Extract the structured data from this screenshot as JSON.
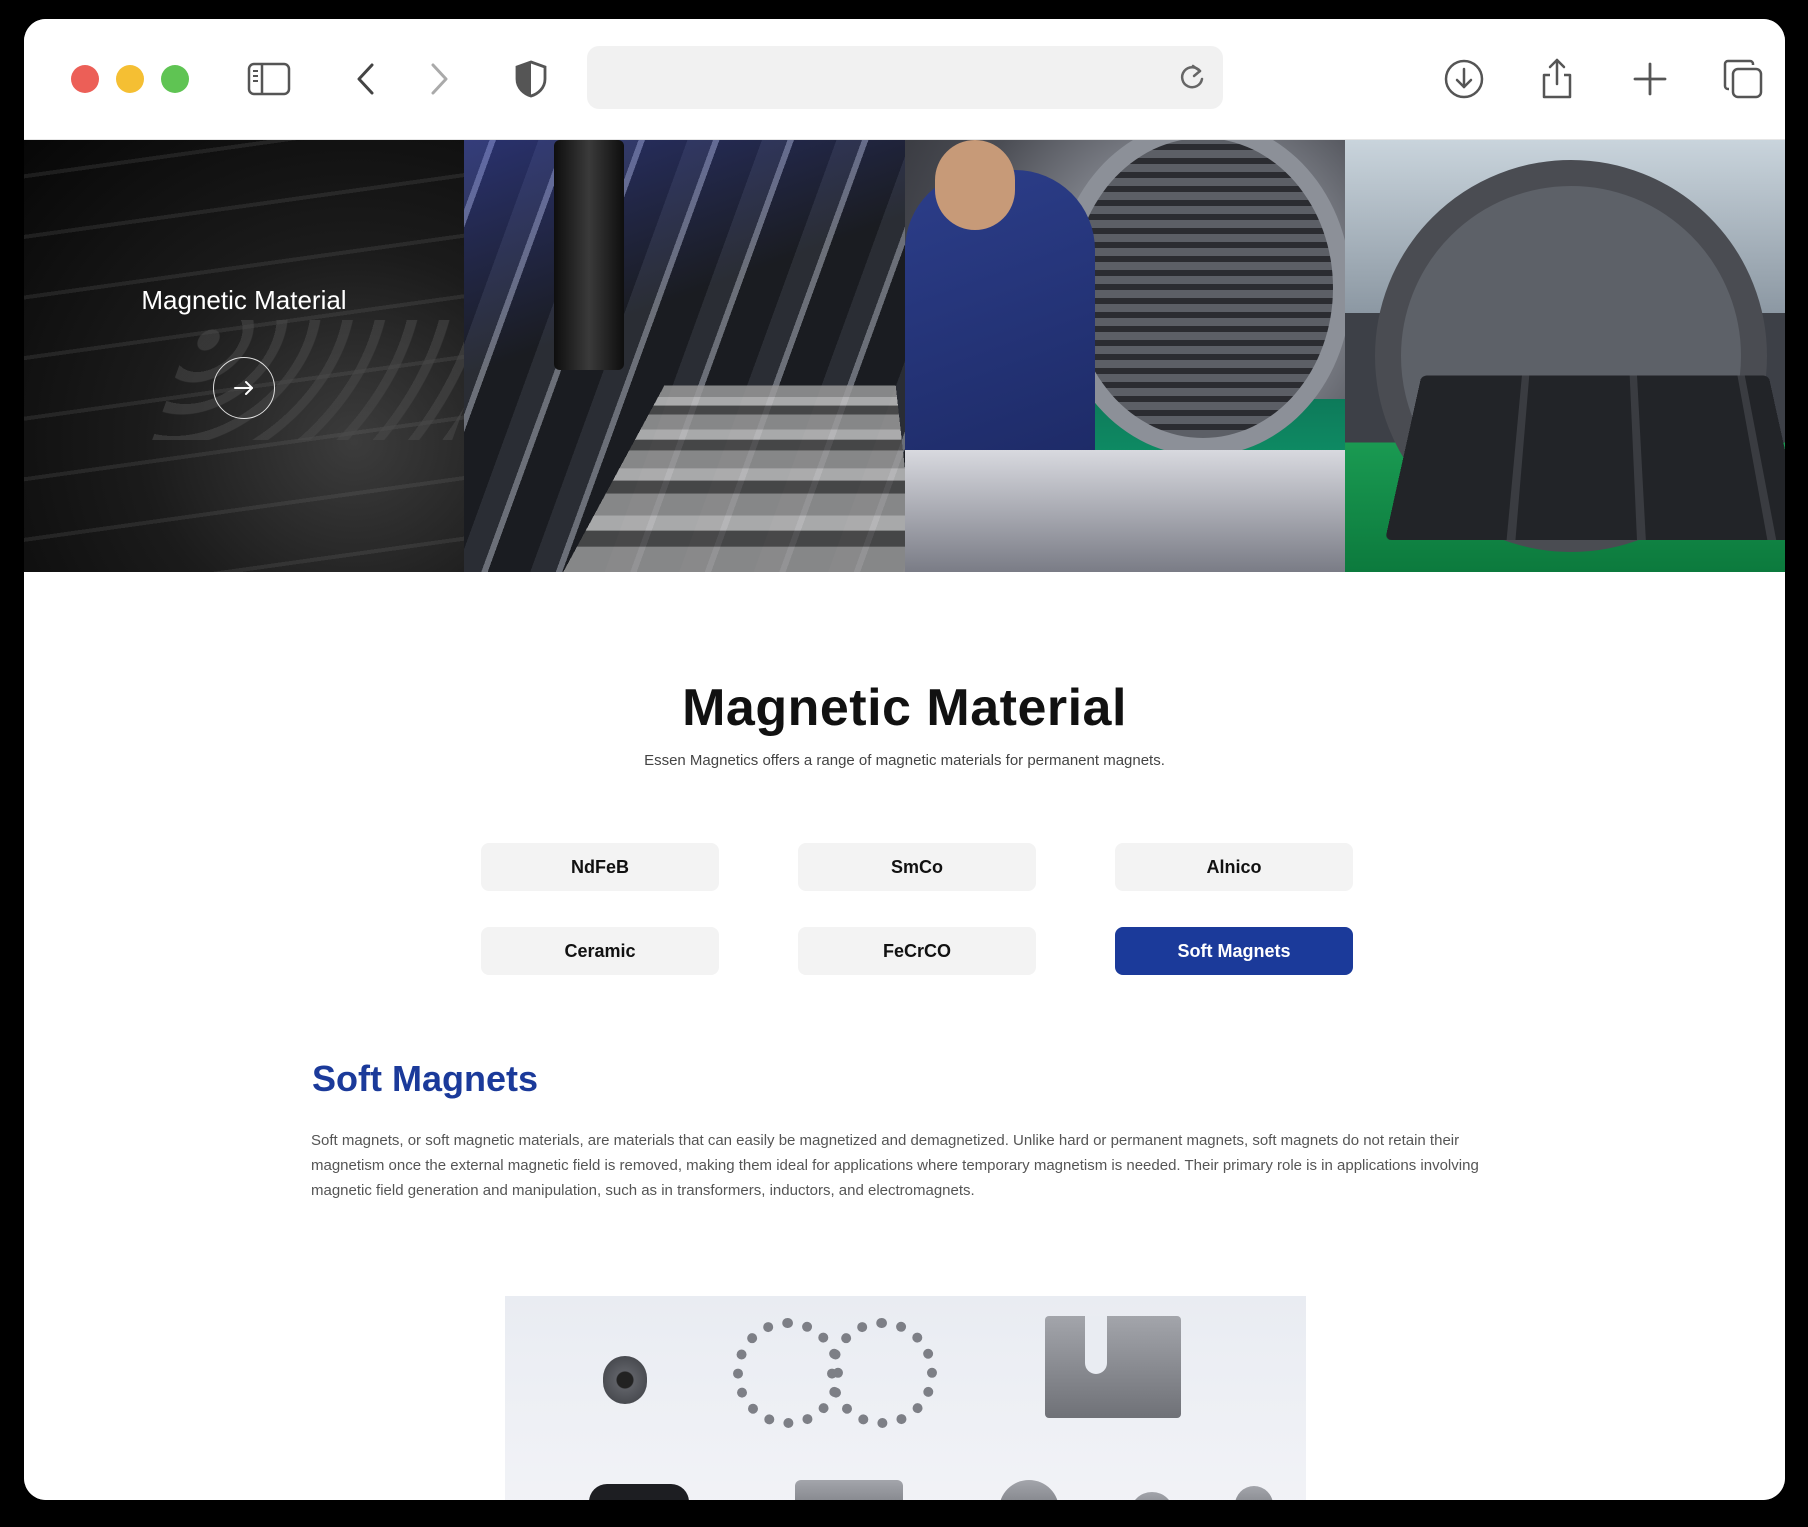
{
  "browser": {
    "url_text": "",
    "icons": [
      "sidebar-icon",
      "back-icon",
      "forward-icon",
      "shield-icon",
      "reload-icon",
      "download-icon",
      "share-icon",
      "new-tab-icon",
      "tabs-icon"
    ]
  },
  "hero": {
    "title": "Magnetic Material",
    "arrow": "→"
  },
  "main": {
    "title": "Magnetic Material",
    "subtitle": "Essen Magnetics offers a range of magnetic materials for permanent magnets.",
    "tabs": [
      {
        "label": "NdFeB"
      },
      {
        "label": "SmCo"
      },
      {
        "label": "Alnico"
      },
      {
        "label": "Ceramic"
      },
      {
        "label": "FeCrCO"
      },
      {
        "label": "Soft Magnets"
      }
    ],
    "active_tab": "Soft Magnets",
    "section": {
      "title": "Soft Magnets",
      "body": "Soft magnets, or soft magnetic materials, are materials that can easily be magnetized and demagnetized. Unlike hard or permanent magnets, soft magnets do not retain their magnetism once the external magnetic field is removed, making them ideal for applications where temporary magnetism is needed. Their primary role is in applications involving magnetic field generation and manipulation, such as in transformers, inductors, and electromagnets."
    }
  },
  "colors": {
    "accent": "#1b3a9a",
    "tab_bg": "#f3f3f3"
  }
}
